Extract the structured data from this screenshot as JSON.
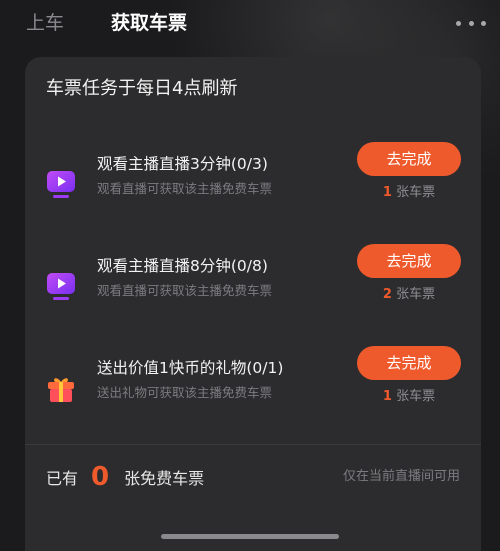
{
  "header": {
    "tab_inactive": "上车",
    "tab_active": "获取车票"
  },
  "panel": {
    "title": "车票任务于每日4点刷新",
    "tasks": [
      {
        "name": "观看主播直播3分钟(0/3)",
        "desc": "观看直播可获取该主播免费车票",
        "button": "去完成",
        "reward_count": "1",
        "reward_unit": "张车票",
        "icon": "play-tv-icon"
      },
      {
        "name": "观看主播直播8分钟(0/8)",
        "desc": "观看直播可获取该主播免费车票",
        "button": "去完成",
        "reward_count": "2",
        "reward_unit": "张车票",
        "icon": "play-tv-icon"
      },
      {
        "name": "送出价值1快币的礼物(0/1)",
        "desc": "送出礼物可获取该主播免费车票",
        "button": "去完成",
        "reward_count": "1",
        "reward_unit": "张车票",
        "icon": "gift-box-icon"
      }
    ]
  },
  "footer": {
    "prefix": "已有",
    "count": "0",
    "suffix": "张免费车票",
    "note": "仅在当前直播间可用"
  },
  "colors": {
    "accent": "#ef5a2c",
    "panel": "#2c2c2e",
    "background": "#1b1b1d",
    "icon_purple": "#9b3cf2"
  }
}
